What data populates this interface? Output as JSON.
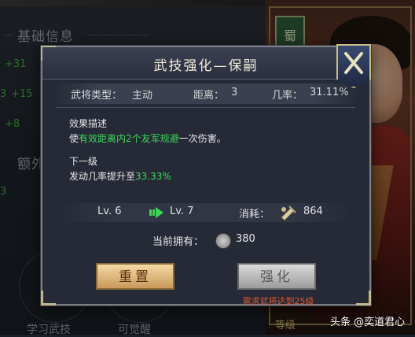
{
  "background": {
    "section_basic": "基础信息",
    "section_extra": "额外",
    "stats": [
      "+31",
      "+15",
      "+8"
    ],
    "stat_prefixes": [
      "3"
    ],
    "bottom_left_button": "学习武技",
    "bottom_mid_button": "可觉醒",
    "bottom_right_tab": "等级",
    "faction_badge": "蜀",
    "watermark": "头条 @奕道君心"
  },
  "modal": {
    "title": "武技强化—保嗣",
    "general_type_label": "武将类型：",
    "general_type_value": "主动",
    "distance_label": "距离：",
    "distance_value": "3",
    "chance_label": "几率：",
    "chance_value": "31.11%",
    "effect_heading": "效果描述",
    "effect_prefix": "使",
    "effect_highlight": "有效距离内2个友军规避",
    "effect_suffix": "一次伤害。",
    "next_heading": "下一级",
    "next_prefix": "发动几率提升至",
    "next_value": "33.33%",
    "level_from": "Lv. 6",
    "level_to": "Lv. 7",
    "cost_label": "消耗：",
    "cost_value": "864",
    "own_label": "当前拥有：",
    "own_value": "380",
    "reset_button": "重置",
    "upgrade_button": "强化",
    "requirement_note": "需求武将达到25级"
  },
  "colors": {
    "accent_green": "#3ed65a",
    "warning_red": "#e2562e",
    "gold": "#c9bd8a"
  },
  "icons": [
    "close-icon",
    "arrow-right-icon",
    "skill-scroll-icon",
    "skill-token-icon"
  ]
}
